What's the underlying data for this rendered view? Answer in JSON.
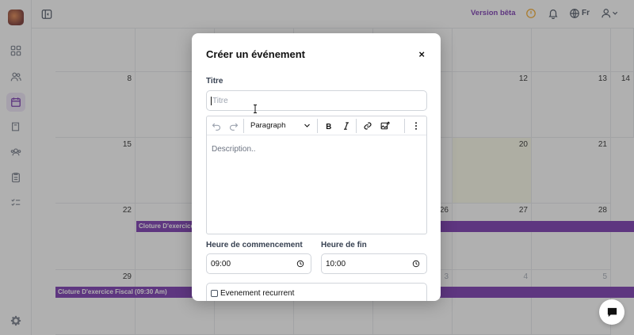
{
  "topbar": {
    "version_label": "Version bêta",
    "language": "Fr"
  },
  "calendar": {
    "rows": [
      [
        "",
        "",
        "",
        "",
        "",
        "",
        "",
        ""
      ],
      [
        "8",
        "",
        "",
        "",
        "",
        "12",
        "13",
        "14"
      ],
      [
        "15",
        "",
        "",
        "",
        "",
        "19",
        "20",
        "21"
      ],
      [
        "22",
        "",
        "",
        "",
        "",
        "26",
        "27",
        "28"
      ],
      [
        "29",
        "",
        "",
        "",
        "",
        "3",
        "4",
        "5"
      ]
    ],
    "events": [
      {
        "label": "Cloture D'exercice Fiscal (09:30 Am)"
      },
      {
        "label": "Cloture D'exercice Fiscal (09:30 Am)"
      }
    ]
  },
  "modal": {
    "title": "Créer un événement",
    "close": "×",
    "title_label": "Titre",
    "title_placeholder": "Titre",
    "toolbar": {
      "block_format": "Paragraph"
    },
    "description_placeholder": "Description..",
    "start_label": "Heure de commencement",
    "start_value": "09:00",
    "end_label": "Heure de fin",
    "end_value": "10:00",
    "recurrent_label": "Evenement recurrent"
  },
  "colors": {
    "accent": "#6b21a8",
    "today_bg": "#fbfbe8",
    "warning": "#f59e0b"
  }
}
